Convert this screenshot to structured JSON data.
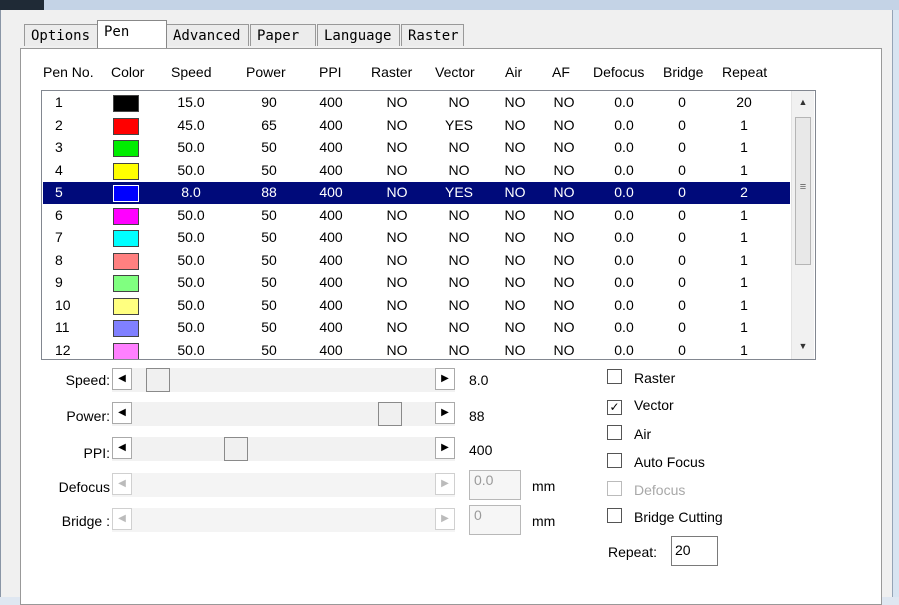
{
  "tabs": [
    "Options",
    "Pen",
    "Advanced",
    "Paper",
    "Language",
    "Raster"
  ],
  "active_tab": "Pen",
  "pen_table": {
    "columns": [
      "Pen No.",
      "Color",
      "Speed",
      "Power",
      "PPI",
      "Raster",
      "Vector",
      "Air",
      "AF",
      "Defocus",
      "Bridge",
      "Repeat"
    ],
    "rows": [
      {
        "pen": "1",
        "color": "#000000",
        "speed": "15.0",
        "power": "90",
        "ppi": "400",
        "raster": "NO",
        "vector": "NO",
        "air": "NO",
        "af": "NO",
        "defocus": "0.0",
        "bridge": "0",
        "repeat": "20"
      },
      {
        "pen": "2",
        "color": "#ff0000",
        "speed": "45.0",
        "power": "65",
        "ppi": "400",
        "raster": "NO",
        "vector": "YES",
        "air": "NO",
        "af": "NO",
        "defocus": "0.0",
        "bridge": "0",
        "repeat": "1"
      },
      {
        "pen": "3",
        "color": "#00ee00",
        "speed": "50.0",
        "power": "50",
        "ppi": "400",
        "raster": "NO",
        "vector": "NO",
        "air": "NO",
        "af": "NO",
        "defocus": "0.0",
        "bridge": "0",
        "repeat": "1"
      },
      {
        "pen": "4",
        "color": "#ffff00",
        "speed": "50.0",
        "power": "50",
        "ppi": "400",
        "raster": "NO",
        "vector": "NO",
        "air": "NO",
        "af": "NO",
        "defocus": "0.0",
        "bridge": "0",
        "repeat": "1"
      },
      {
        "pen": "5",
        "color": "#0000ff",
        "speed": "8.0",
        "power": "88",
        "ppi": "400",
        "raster": "NO",
        "vector": "YES",
        "air": "NO",
        "af": "NO",
        "defocus": "0.0",
        "bridge": "0",
        "repeat": "2"
      },
      {
        "pen": "6",
        "color": "#ff00ff",
        "speed": "50.0",
        "power": "50",
        "ppi": "400",
        "raster": "NO",
        "vector": "NO",
        "air": "NO",
        "af": "NO",
        "defocus": "0.0",
        "bridge": "0",
        "repeat": "1"
      },
      {
        "pen": "7",
        "color": "#00ffff",
        "speed": "50.0",
        "power": "50",
        "ppi": "400",
        "raster": "NO",
        "vector": "NO",
        "air": "NO",
        "af": "NO",
        "defocus": "0.0",
        "bridge": "0",
        "repeat": "1"
      },
      {
        "pen": "8",
        "color": "#ff8080",
        "speed": "50.0",
        "power": "50",
        "ppi": "400",
        "raster": "NO",
        "vector": "NO",
        "air": "NO",
        "af": "NO",
        "defocus": "0.0",
        "bridge": "0",
        "repeat": "1"
      },
      {
        "pen": "9",
        "color": "#80ff80",
        "speed": "50.0",
        "power": "50",
        "ppi": "400",
        "raster": "NO",
        "vector": "NO",
        "air": "NO",
        "af": "NO",
        "defocus": "0.0",
        "bridge": "0",
        "repeat": "1"
      },
      {
        "pen": "10",
        "color": "#ffff80",
        "speed": "50.0",
        "power": "50",
        "ppi": "400",
        "raster": "NO",
        "vector": "NO",
        "air": "NO",
        "af": "NO",
        "defocus": "0.0",
        "bridge": "0",
        "repeat": "1"
      },
      {
        "pen": "11",
        "color": "#8080ff",
        "speed": "50.0",
        "power": "50",
        "ppi": "400",
        "raster": "NO",
        "vector": "NO",
        "air": "NO",
        "af": "NO",
        "defocus": "0.0",
        "bridge": "0",
        "repeat": "1"
      },
      {
        "pen": "12",
        "color": "#ff80ff",
        "speed": "50.0",
        "power": "50",
        "ppi": "400",
        "raster": "NO",
        "vector": "NO",
        "air": "NO",
        "af": "NO",
        "defocus": "0.0",
        "bridge": "0",
        "repeat": "1"
      }
    ],
    "selected_pen": "5",
    "scroll_icon_up": "scroll-up-arrow-icon",
    "scroll_icon_down": "scroll-down-arrow-icon",
    "selection_color": "#000a7a"
  },
  "sliders": {
    "speed": {
      "label": "Speed:",
      "value": "8.0",
      "level": 0.05,
      "enabled": true
    },
    "power": {
      "label": "Power:",
      "value": "88",
      "level": 0.88,
      "enabled": true
    },
    "ppi": {
      "label": "PPI:",
      "value": "400",
      "level": 0.33,
      "enabled": true
    },
    "defocus": {
      "label": "Defocus",
      "value": "0.0",
      "unit": "mm",
      "enabled": false
    },
    "bridge": {
      "label": "Bridge :",
      "value": "0",
      "unit": "mm",
      "enabled": false
    }
  },
  "options": [
    {
      "label": "Raster",
      "checked": false,
      "enabled": true
    },
    {
      "label": "Vector",
      "checked": true,
      "enabled": true
    },
    {
      "label": "Air",
      "checked": false,
      "enabled": true
    },
    {
      "label": "Auto Focus",
      "checked": false,
      "enabled": true
    },
    {
      "label": "Defocus",
      "checked": false,
      "enabled": false
    },
    {
      "label": "Bridge Cutting",
      "checked": false,
      "enabled": true
    }
  ],
  "repeat": {
    "label": "Repeat:",
    "value": "20"
  }
}
